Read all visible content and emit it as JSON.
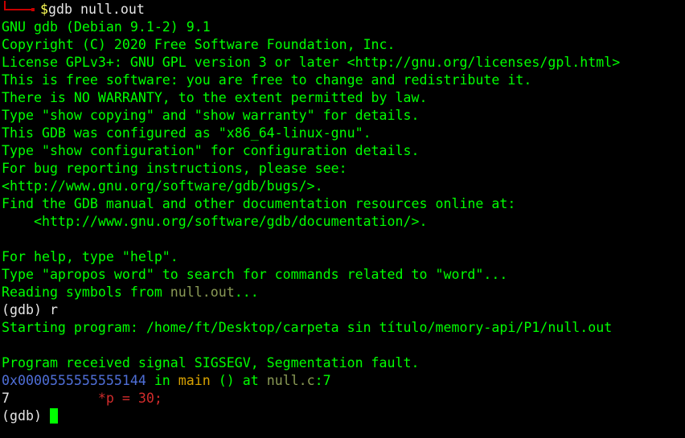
{
  "command": {
    "dollar": "$",
    "text": "gdb null.out"
  },
  "banner": {
    "version": "GNU gdb (Debian 9.1-2) 9.1",
    "copyright": "Copyright (C) 2020 Free Software Foundation, Inc.",
    "license": "License GPLv3+: GNU GPL version 3 or later <http://gnu.org/licenses/gpl.html>",
    "free": "This is free software: you are free to change and redistribute it.",
    "warranty": "There is NO WARRANTY, to the extent permitted by law.",
    "show_copying": "Type \"show copying\" and \"show warranty\" for details.",
    "configured": "This GDB was configured as \"x86_64-linux-gnu\".",
    "show_config": "Type \"show configuration\" for configuration details.",
    "bug_reporting": "For bug reporting instructions, please see:",
    "bugs_url": "<http://www.gnu.org/software/gdb/bugs/>.",
    "manual": "Find the GDB manual and other documentation resources online at:",
    "manual_url": "    <http://www.gnu.org/software/gdb/documentation/>.",
    "help": "For help, type \"help\".",
    "apropos": "Type \"apropos word\" to search for commands related to \"word\"..."
  },
  "reading": {
    "prefix": "Reading symbols from ",
    "file": "null.out",
    "suffix": "..."
  },
  "run": {
    "prompt": "(gdb) ",
    "command": "r"
  },
  "starting": "Starting program: /home/ft/Desktop/carpeta sin título/memory-api/P1/null.out",
  "signal": "Program received signal SIGSEGV, Segmentation fault.",
  "frame": {
    "address": "0x0000555555555144",
    "in": " in ",
    "function": "main",
    "args_at": " () at ",
    "file": "null.c",
    "line_sep": ":7"
  },
  "source": {
    "lineno": "7",
    "spacing": "           ",
    "pointer": "*p",
    "eq": " = ",
    "value": "30",
    "semi": ";"
  },
  "final_prompt": "(gdb) ",
  "colors": {
    "background": "#000000",
    "text": "#00ff00",
    "prompt_corner": "#c80000",
    "address": "#4f6fd8",
    "function": "#d8a200",
    "file": "#8a9a55",
    "literal": "#d22c2c"
  }
}
